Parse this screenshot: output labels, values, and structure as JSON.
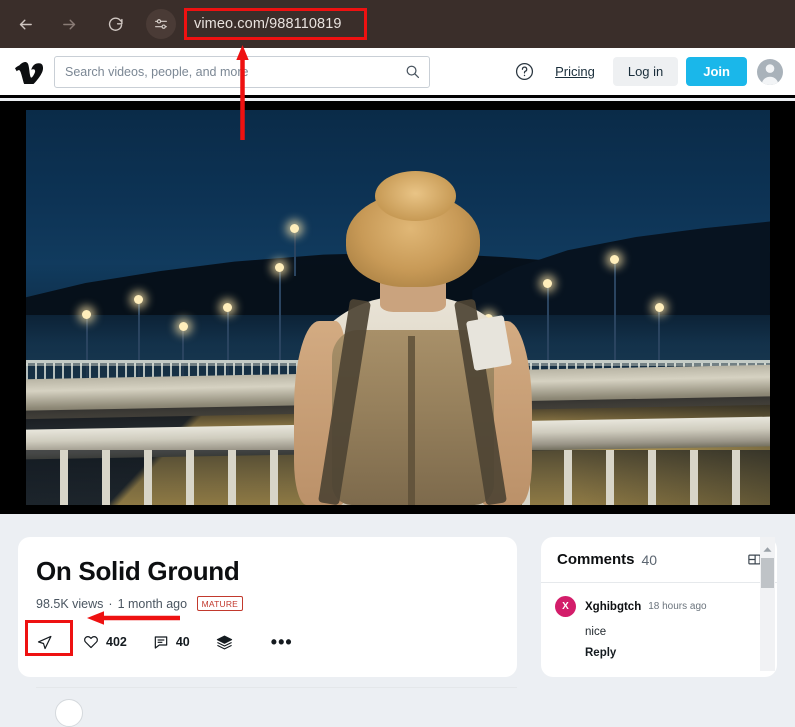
{
  "browser": {
    "back_icon": "arrow-left-icon",
    "forward_icon": "arrow-right-icon",
    "reload_icon": "reload-icon",
    "tune_icon": "tune-sliders-icon",
    "url": "vimeo.com/988110819",
    "chrome_color": "#3a2e2a",
    "highlight_color": "#ee1111"
  },
  "header": {
    "logo_name": "vimeo-logo",
    "search": {
      "placeholder": "Search videos, people, and more",
      "value": "",
      "icon": "search-icon"
    },
    "help_icon": "help-circle-icon",
    "pricing_label": "Pricing",
    "login_label": "Log in",
    "join_label": "Join",
    "join_color": "#1ab7ea",
    "avatar_name": "user-avatar"
  },
  "video": {
    "title": "On Solid Ground",
    "views": "98.5K views",
    "separator": "·",
    "published": "1 month ago",
    "badge": "MATURE",
    "badge_color": "#c2392d"
  },
  "actions": {
    "share": {
      "icon": "share-paper-plane-icon",
      "label": ""
    },
    "like": {
      "icon": "heart-icon",
      "count": "402"
    },
    "comment": {
      "icon": "comment-bubble-icon",
      "count": "40"
    },
    "collection": {
      "icon": "stack-collection-icon",
      "count": ""
    },
    "more": {
      "icon": "more-horizontal-icon",
      "label": "•••"
    }
  },
  "comments": {
    "title": "Comments",
    "count": "40",
    "panel_icon": "panel-layout-icon",
    "items": [
      {
        "avatar_letter": "X",
        "avatar_color": "#d31d6a",
        "username": "Xghibgtch",
        "time": "18 hours ago",
        "text": "nice",
        "reply_label": "Reply"
      }
    ]
  },
  "scrollbar": {
    "up_icon": "scroll-up-arrow-icon"
  },
  "annotations": {
    "url_arrow": "red-arrow-up-to-url",
    "share_arrow": "red-arrow-left-to-share",
    "url_box": "red-highlight-url-bar",
    "share_box": "red-highlight-share-button"
  }
}
